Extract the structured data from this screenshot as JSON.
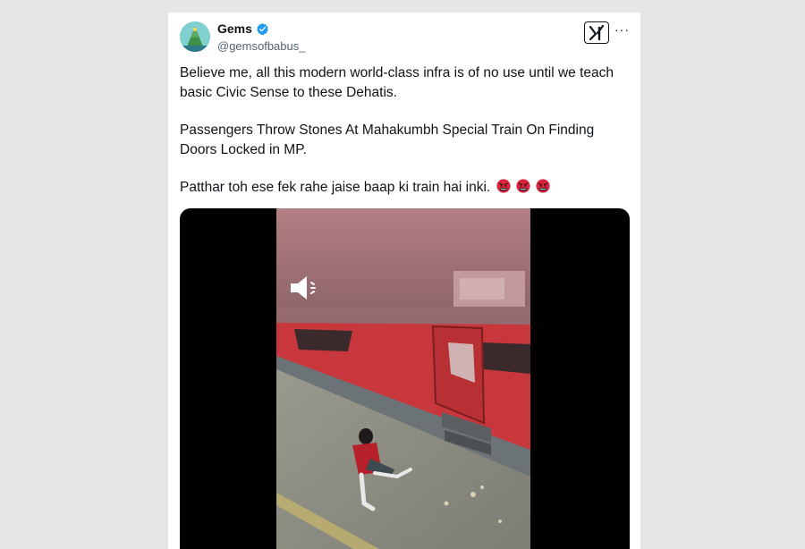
{
  "user": {
    "display_name": "Gems",
    "handle": "@gemsofbabus_",
    "verified_icon": "verified-badge-icon",
    "avatar_icon": "mountain-avatar-icon"
  },
  "header": {
    "grok_icon": "grok-icon",
    "more_label": "···"
  },
  "tweet": {
    "paragraph_1": "Believe me, all this modern world-class infra is of no use until we teach basic Civic Sense to these Dehatis.",
    "paragraph_2": "Passengers Throw Stones At Mahakumbh Special Train On Finding Doors Locked in MP.",
    "paragraph_3": "Patthar toh ese fek rahe jaise baap ki train hai inki.",
    "emoji_icon": "angry-face-icon",
    "emoji_count": 3
  },
  "media": {
    "type": "video",
    "mute_icon": "speaker-muted-icon"
  },
  "colors": {
    "verified": "#1d9bf0",
    "text": "#0f1419",
    "secondary": "#536471",
    "train_red": "#c8373b",
    "platform": "#8c8c82",
    "page_bg": "#e6e6e6"
  }
}
